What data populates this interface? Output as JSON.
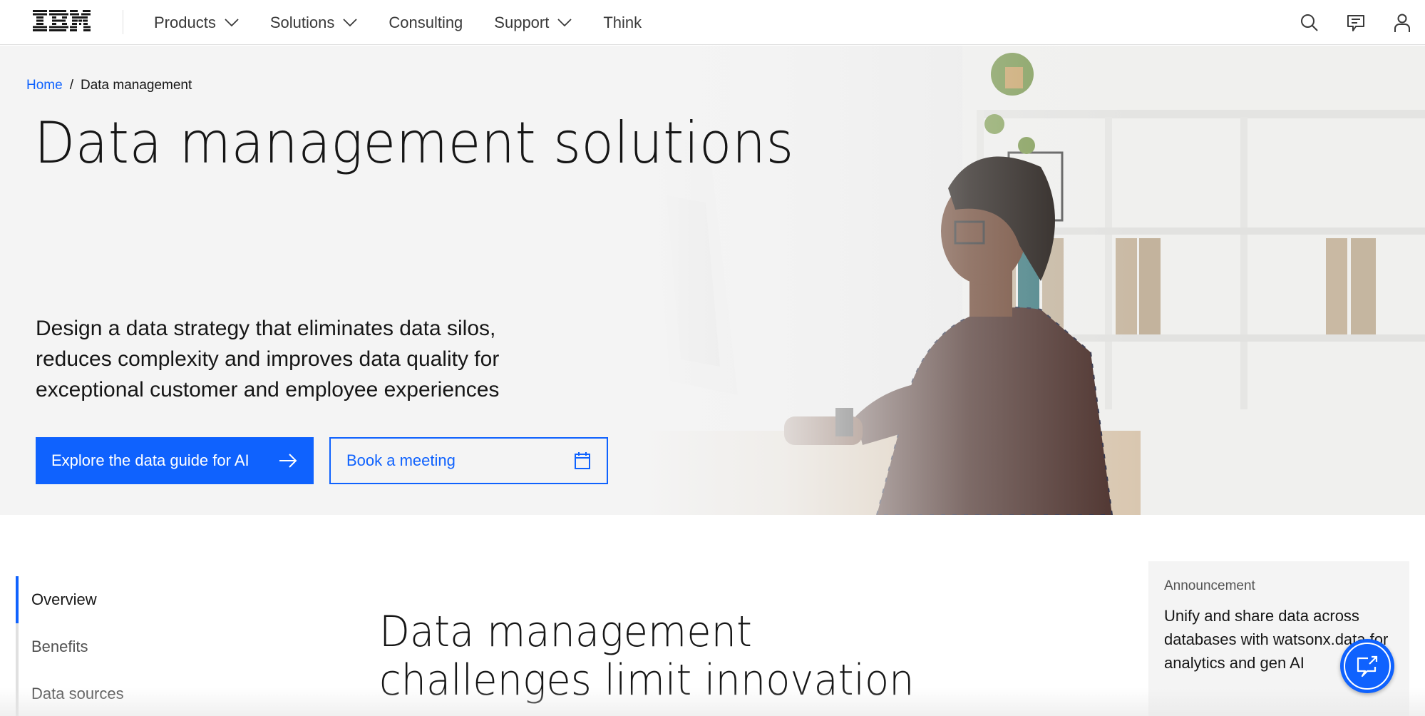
{
  "masthead": {
    "logo_text": "IBM",
    "nav": [
      {
        "label": "Products",
        "has_dropdown": true
      },
      {
        "label": "Solutions",
        "has_dropdown": true
      },
      {
        "label": "Consulting",
        "has_dropdown": false
      },
      {
        "label": "Support",
        "has_dropdown": true
      },
      {
        "label": "Think",
        "has_dropdown": false
      }
    ],
    "icons": [
      "search-icon",
      "chat-icon",
      "user-icon"
    ]
  },
  "hero": {
    "breadcrumb": {
      "home": "Home",
      "separator": "/",
      "current": "Data management"
    },
    "title": "Data management solutions",
    "description": "Design a data strategy that eliminates data silos, reduces complexity and improves data quality for exceptional customer and employee experiences",
    "primary_button": {
      "label": "Explore the data guide for AI",
      "icon": "arrow-right-icon"
    },
    "secondary_button": {
      "label": "Book a meeting",
      "icon": "calendar-icon"
    }
  },
  "toc": {
    "items": [
      {
        "label": "Overview",
        "active": true
      },
      {
        "label": "Benefits",
        "active": false
      },
      {
        "label": "Data sources",
        "active": false
      }
    ]
  },
  "section": {
    "title": "Data management challenges limit innovation"
  },
  "announcement": {
    "label": "Announcement",
    "text": "Unify and share data across databases with watsonx.data for analytics and gen AI"
  },
  "chat": {
    "icon": "launch-chat-icon"
  },
  "colors": {
    "brand_blue": "#0f62fe",
    "text_primary": "#161616",
    "text_secondary": "#525252",
    "hero_bg": "#f4f4f4"
  }
}
